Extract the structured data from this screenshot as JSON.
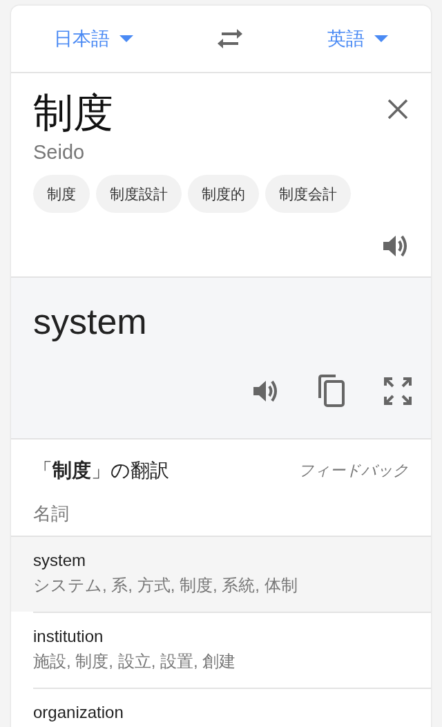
{
  "languages": {
    "source": "日本語",
    "target": "英語"
  },
  "source": {
    "text": "制度",
    "romanization": "Seido",
    "suggestions": [
      "制度",
      "制度設計",
      "制度的",
      "制度会計"
    ]
  },
  "target": {
    "text": "system"
  },
  "translations": {
    "title": "「**制度**」の翻訳",
    "feedback": "フィードバック",
    "part_of_speech": "名詞",
    "rows": [
      {
        "word": "system",
        "meanings": "システム, 系, 方式, 制度, 系統, 体制",
        "selected": true
      },
      {
        "word": "institution",
        "meanings": "施設, 制度, 設立, 設置, 創建",
        "selected": false
      },
      {
        "word": "organization",
        "selected": false
      }
    ]
  }
}
